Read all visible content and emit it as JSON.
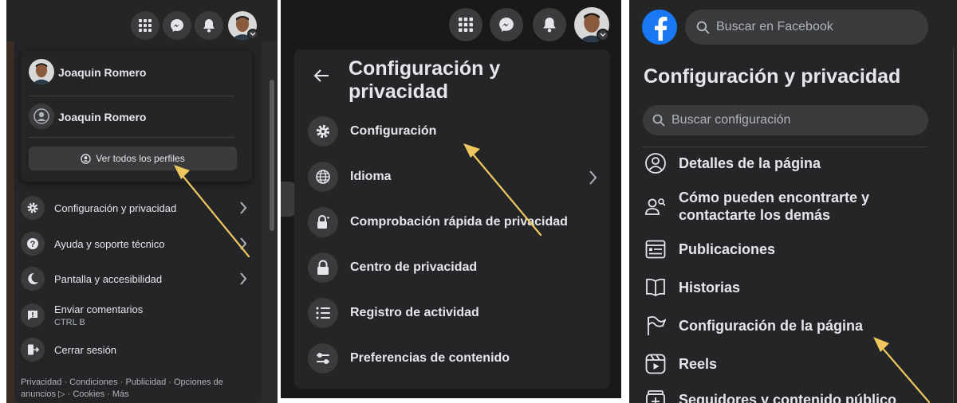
{
  "panel1": {
    "profiles": [
      {
        "name": "Joaquin Romero"
      },
      {
        "name": "Joaquin Romero"
      }
    ],
    "see_all_profiles": "Ver todos los perfiles",
    "menu_items": [
      {
        "label": "Configuración y privacidad",
        "icon": "gear-icon",
        "has_chevron": true
      },
      {
        "label": "Ayuda y soporte técnico",
        "icon": "help-icon",
        "has_chevron": true
      },
      {
        "label": "Pantalla y accesibilidad",
        "icon": "moon-icon",
        "has_chevron": true
      },
      {
        "label": "Enviar comentarios",
        "sublabel": "CTRL B",
        "icon": "feedback-icon",
        "has_chevron": false
      },
      {
        "label": "Cerrar sesión",
        "icon": "logout-icon",
        "has_chevron": false
      }
    ],
    "footer": {
      "line1": "Privacidad · Condiciones · Publicidad · Opciones de",
      "line2": "anuncios ▷ · Cookies · Más"
    }
  },
  "panel2": {
    "title": "Configuración y privacidad",
    "menu_items": [
      {
        "label": "Configuración",
        "icon": "gear-icon"
      },
      {
        "label": "Idioma",
        "icon": "globe-icon",
        "has_chevron": true
      },
      {
        "label": "Comprobación rápida de privacidad",
        "icon": "lock-heart-icon"
      },
      {
        "label": "Centro de privacidad",
        "icon": "lock-icon"
      },
      {
        "label": "Registro de actividad",
        "icon": "list-icon"
      },
      {
        "label": "Preferencias de contenido",
        "icon": "sliders-icon"
      }
    ]
  },
  "panel3": {
    "search_placeholder": "Buscar en Facebook",
    "title": "Configuración y privacidad",
    "settings_search_placeholder": "Buscar configuración",
    "menu_items": [
      {
        "label": "Detalles de la página",
        "icon": "user-circle-icon"
      },
      {
        "label": "Cómo pueden encontrarte y contactarte los demás",
        "icon": "user-search-icon"
      },
      {
        "label": "Publicaciones",
        "icon": "newsfeed-icon"
      },
      {
        "label": "Historias",
        "icon": "book-icon"
      },
      {
        "label": "Configuración de la página",
        "icon": "flag-icon"
      },
      {
        "label": "Reels",
        "icon": "reels-icon"
      },
      {
        "label": "Seguidores y contenido público",
        "icon": "followers-icon"
      }
    ]
  },
  "colors": {
    "background": "#242526",
    "hover": "#3a3b3c",
    "text": "#e4e6eb",
    "secondary_text": "#b0b3b8",
    "facebook_blue": "#1877f2",
    "annotation_arrow": "#f0c75e"
  }
}
